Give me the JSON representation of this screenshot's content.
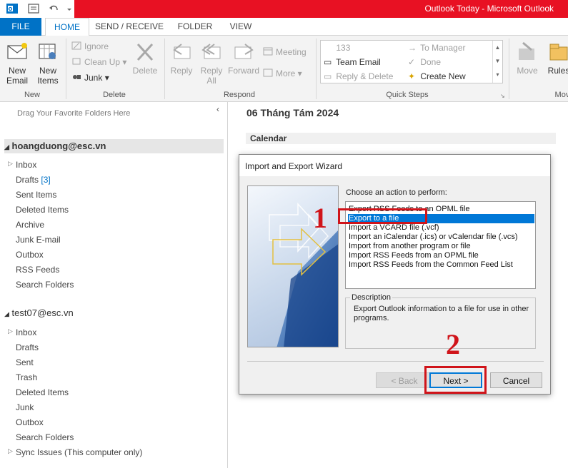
{
  "window": {
    "title": "Outlook Today - Microsoft Outlook",
    "title_color": "#e81123"
  },
  "quick_access": [
    "outlook-icon",
    "send-receive-all-icon",
    "undo-icon",
    "customize-icon"
  ],
  "tabs": [
    {
      "label": "FILE"
    },
    {
      "label": "HOME"
    },
    {
      "label": "SEND / RECEIVE"
    },
    {
      "label": "FOLDER"
    },
    {
      "label": "VIEW"
    }
  ],
  "ribbon": {
    "new": {
      "new_email": "New\nEmail",
      "new_items": "New\nItems",
      "label": "New"
    },
    "delete": {
      "ignore": "Ignore",
      "clean_up": "Clean Up",
      "junk": "Junk",
      "delete": "Delete",
      "label": "Delete"
    },
    "respond": {
      "reply": "Reply",
      "reply_all": "Reply\nAll",
      "forward": "Forward",
      "meeting": "Meeting",
      "more": "More",
      "label": "Respond"
    },
    "quick_steps": {
      "items": [
        "133",
        "Team Email",
        "Reply & Delete",
        "To Manager",
        "Done",
        "Create New"
      ],
      "label": "Quick Steps"
    },
    "move": {
      "move": "Move",
      "rules": "Rules",
      "label": "Move"
    }
  },
  "folder_pane": {
    "drag_hint": "Drag Your Favorite Folders Here",
    "account1": {
      "name": "hoangduong@esc.vn",
      "folders": [
        {
          "label": "Inbox"
        },
        {
          "label": "Drafts",
          "count": "[3]"
        },
        {
          "label": "Sent Items"
        },
        {
          "label": "Deleted Items"
        },
        {
          "label": "Archive"
        },
        {
          "label": "Junk E-mail"
        },
        {
          "label": "Outbox"
        },
        {
          "label": "RSS Feeds"
        },
        {
          "label": "Search Folders"
        }
      ]
    },
    "account2": {
      "name": "test07@esc.vn",
      "folders": [
        {
          "label": "Inbox"
        },
        {
          "label": "Drafts"
        },
        {
          "label": "Sent"
        },
        {
          "label": "Trash"
        },
        {
          "label": "Deleted Items"
        },
        {
          "label": "Junk"
        },
        {
          "label": "Outbox"
        },
        {
          "label": "Search Folders"
        },
        {
          "label": "Sync Issues (This computer only)"
        }
      ]
    }
  },
  "main": {
    "date": "06 Tháng Tám 2024",
    "calendar_header": "Calendar"
  },
  "dialog": {
    "title": "Import and Export Wizard",
    "prompt": "Choose an action to perform:",
    "actions": [
      "Export RSS Feeds to an OPML file",
      "Export to a file",
      "Import a VCARD file (.vcf)",
      "Import an iCalendar (.ics) or vCalendar file (.vcs)",
      "Import from another program or file",
      "Import RSS Feeds from an OPML file",
      "Import RSS Feeds from the Common Feed List"
    ],
    "selected_index": 1,
    "description_label": "Description",
    "description": "Export Outlook information to a file for use in other programs.",
    "back_label": "< Back",
    "next_label": "Next >",
    "cancel_label": "Cancel"
  },
  "annotations": {
    "step1": "1",
    "step2": "2",
    "color": "#d0141a"
  }
}
